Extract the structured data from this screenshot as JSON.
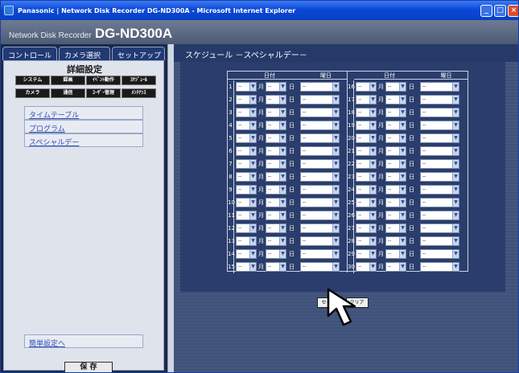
{
  "window": {
    "title": "Panasonic | Network Disk Recorder DG-ND300A - Microsoft Internet Explorer"
  },
  "app": {
    "subtitle": "Network Disk Recorder",
    "model": "DG-ND300A"
  },
  "tabs": [
    {
      "label": "コントロール"
    },
    {
      "label": "カメラ選択"
    },
    {
      "label": "セットアップ"
    }
  ],
  "setup": {
    "title": "詳細設定",
    "buttons": [
      "システム",
      "録画",
      "ｲﾍﾞﾝﾄ動作",
      "ｽｹｼﾞｭｰﾙ",
      "カメラ",
      "通信",
      "ﾕｰｻﾞｰ管理",
      "ﾒﾝﾃﾅﾝｽ"
    ],
    "menu": [
      "タイムテーブル",
      "プログラム",
      "スペシャルデー"
    ],
    "easy_link": "簡単設定へ",
    "save_label": "保 存"
  },
  "page": {
    "title": "スケジュール －スペシャルデー－"
  },
  "schedule": {
    "header_date": "日付",
    "header_weekday": "曜日",
    "month_unit": "月",
    "day_unit": "日",
    "empty_value": "--",
    "left_rows": [
      "1",
      "2",
      "3",
      "4",
      "5",
      "6",
      "7",
      "8",
      "9",
      "10",
      "11",
      "12",
      "13",
      "14",
      "15"
    ],
    "right_rows": [
      "16",
      "17",
      "18",
      "19",
      "20",
      "21",
      "22",
      "23",
      "24",
      "25",
      "26",
      "27",
      "28",
      "29",
      "30"
    ],
    "set_label": "セット",
    "clear_label": "クリア"
  },
  "icons": {
    "cursor": "pointer-arrow-icon",
    "ie": "ie-logo-icon"
  },
  "colors": {
    "titlebar": "#0a48d8",
    "panel": "#dfe3ec",
    "content": "#3f5178"
  }
}
